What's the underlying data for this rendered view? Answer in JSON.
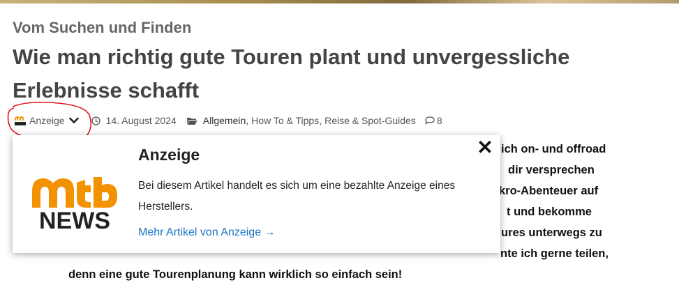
{
  "header": {
    "kicker": "Vom Suchen und Finden",
    "title": "Wie man richtig gute Touren plant und unvergessliche Erlebnisse schafft"
  },
  "meta": {
    "author": "Anzeige",
    "date": "14. August 2024",
    "categories": [
      "Allgemein",
      "How To & Tipps",
      "Reise & Spot-Guides"
    ],
    "category_separator": ",",
    "comment_count": "8"
  },
  "article": {
    "right_fragments": [
      "ich on- und offroad",
      "dir versprechen",
      "kro-Abenteuer auf",
      "t und bekomme",
      "ures unterwegs zu",
      "nte ich gerne teilen,"
    ],
    "last_line": "denn eine gute Tourenplanung kann wirklich so einfach sein!"
  },
  "popup": {
    "title": "Anzeige",
    "text": "Bei diesem Artikel handelt es sich um eine bezahlte Anzeige eines Herstellers.",
    "link": "Mehr Artikel von Anzeige →",
    "close_label": "✕",
    "logo_top": "mtb",
    "logo_bottom": "NEWS"
  },
  "colors": {
    "link": "#1a73c6",
    "brand_orange": "#f39200",
    "annotation": "#e0151c"
  }
}
